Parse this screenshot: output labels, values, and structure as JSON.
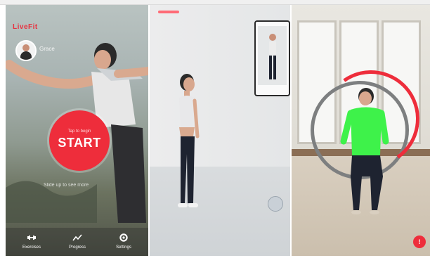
{
  "panel_start": {
    "brand": "LiveFit",
    "username": "Grace",
    "start_sub": "Tap to begin",
    "start_label": "START",
    "hint": "Slide up to see more",
    "tabs": [
      {
        "label": "Exercises",
        "icon": "dumbbell-icon"
      },
      {
        "label": "Progress",
        "icon": "chart-icon"
      },
      {
        "label": "Settings",
        "icon": "gear-icon"
      }
    ]
  },
  "panel_camera": {
    "mode": "posture-check"
  },
  "panel_tracking": {
    "badge": "!"
  },
  "colors": {
    "accent": "#ee2d3b",
    "tracking_overlay": "#3ef24a"
  }
}
